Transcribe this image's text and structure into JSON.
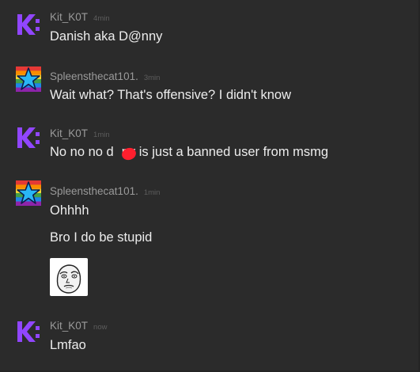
{
  "messages": [
    {
      "username": "Kit_K0T",
      "time": "4min",
      "lines": [
        "Danish aka D@nny"
      ]
    },
    {
      "username": "Spleensthecat101.",
      "time": "3min",
      "lines": [
        "Wait what? That's offensive? I didn't know"
      ]
    },
    {
      "username": "Kit_K0T",
      "time": "1min",
      "lines": [
        "No no no d",
        "ny is just a banned user from msmg"
      ]
    },
    {
      "username": "Spleensthecat101.",
      "time": "1min",
      "lines": [
        "Ohhhh",
        "Bro I do be stupid"
      ]
    },
    {
      "username": "Kit_K0T",
      "time": "now",
      "lines": [
        "Lmfao"
      ]
    }
  ],
  "icons": {
    "kit_avatar": "k-logo-icon",
    "spleens_avatar": "rainbow-star-icon",
    "redaction": "red-scribble-redaction",
    "emote": "okay-face-meme-icon"
  },
  "colors": {
    "background": "#2b2b2b",
    "kit_avatar": "#9146ff",
    "username": "#9a9a9a",
    "timestamp": "#5d5d5d",
    "message_text": "#ededed",
    "redaction": "#ff1f2e"
  }
}
